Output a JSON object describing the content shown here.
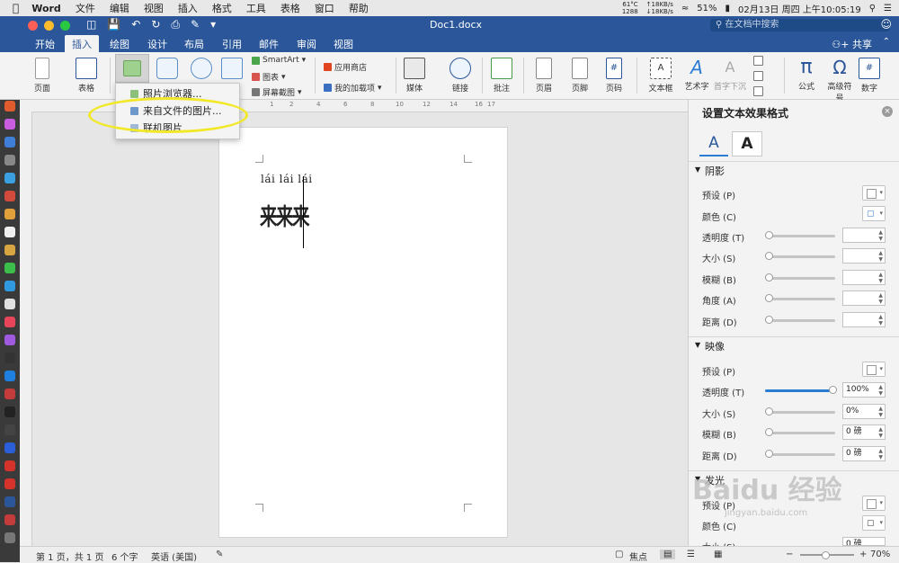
{
  "menubar": {
    "app_name": "Word",
    "items": [
      "文件",
      "编辑",
      "视图",
      "插入",
      "格式",
      "工具",
      "表格",
      "窗口",
      "帮助"
    ],
    "temp": "61°C",
    "fan": "1288",
    "net_up": "↑18KB/s",
    "net_down": "↓18KB/s",
    "battery": "51%",
    "clock": "02月13日 周四 上午10:05:19"
  },
  "titlebar": {
    "doc_title": "Doc1.docx",
    "search_placeholder": "在文档中搜索"
  },
  "tabs": [
    "开始",
    "插入",
    "绘图",
    "设计",
    "布局",
    "引用",
    "邮件",
    "审阅",
    "视图"
  ],
  "active_tab": "插入",
  "share_label": "共享",
  "ribbon": {
    "page": "页面",
    "table": "表格",
    "smartart": "SmartArt",
    "chart": "图表",
    "screenshot": "屏幕截图",
    "app_store": "应用商店",
    "my_addins": "我的加载项",
    "media": "媒体",
    "link": "链接",
    "comment": "批注",
    "header": "页眉",
    "footer": "页脚",
    "page_number": "页码",
    "textbox": "文本框",
    "wordart": "艺术字",
    "dropcap": "首字下沉",
    "equation": "公式",
    "advanced_symbol": "高级符号",
    "number": "数字"
  },
  "dropdown": {
    "items": [
      "照片浏览器...",
      "来自文件的图片...",
      "联机图片..."
    ]
  },
  "ruler_marks": [
    "1",
    "2",
    "4",
    "6",
    "8",
    "10",
    "12",
    "14",
    "16",
    "17"
  ],
  "document": {
    "ruby": "lái lái lái",
    "text": "来来来"
  },
  "pane": {
    "title": "设置文本效果格式",
    "tab1": "A",
    "tab2": "A",
    "shadow": {
      "title": "阴影",
      "preset": "预设 (P)",
      "color": "颜色 (C)",
      "transparency": "透明度 (T)",
      "size": "大小 (S)",
      "blur": "模糊 (B)",
      "angle": "角度 (A)",
      "distance": "距离 (D)"
    },
    "reflection": {
      "title": "映像",
      "preset": "预设 (P)",
      "transparency": "透明度 (T)",
      "transparency_value": "100%",
      "size": "大小 (S)",
      "size_value": "0%",
      "blur": "模糊 (B)",
      "blur_value": "0 磅",
      "distance": "距离 (D)",
      "distance_value": "0 磅"
    },
    "glow": {
      "title": "发光",
      "preset": "预设 (P)",
      "color": "颜色 (C)",
      "size": "大小 (S)",
      "size_value": "0 磅"
    }
  },
  "statusbar": {
    "page": "第 1 页，共 1 页",
    "words": "6 个字",
    "language": "英语 (美国)",
    "focus": "焦点",
    "zoom": "70%"
  },
  "watermark": {
    "logo": "Baidu 经验",
    "url": "jingyan.baidu.com"
  },
  "colors": {
    "word_blue": "#2b579a",
    "highlight": "#f2e82a"
  }
}
